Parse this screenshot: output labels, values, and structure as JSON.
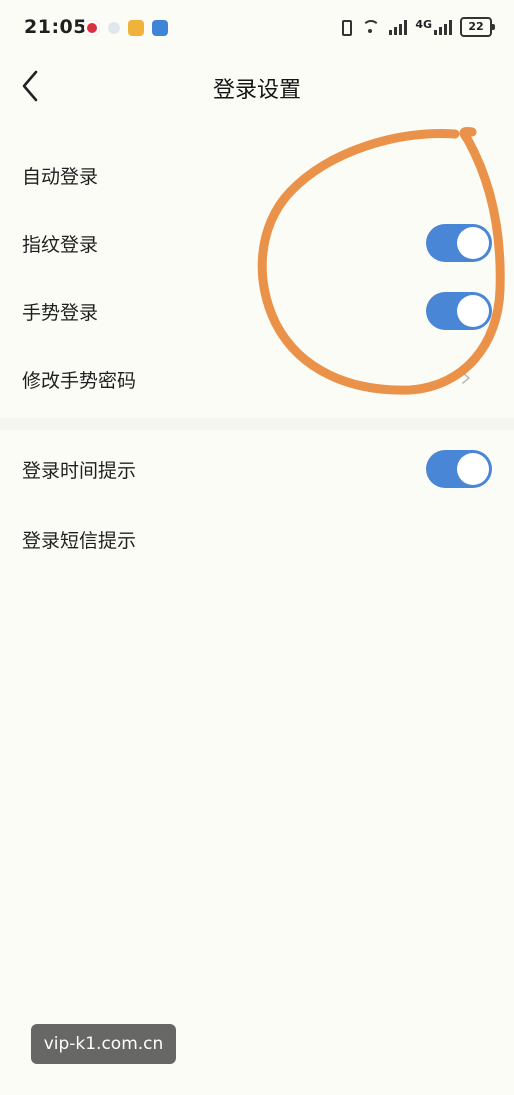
{
  "status_bar": {
    "time": "21:05",
    "network": "4G",
    "battery": "22",
    "notif_icons": [
      "target-icon",
      "dot-icon",
      "folder-icon",
      "compass-icon"
    ]
  },
  "header": {
    "title": "登录设置",
    "back_icon": "chevron-left-icon"
  },
  "settings": [
    {
      "label": "自动登录",
      "control": "none"
    },
    {
      "label": "指纹登录",
      "control": "toggle",
      "on": true
    },
    {
      "label": "手势登录",
      "control": "toggle",
      "on": true
    },
    {
      "label": "修改手势密码",
      "control": "chevron"
    },
    {
      "label": "登录时间提示",
      "control": "toggle",
      "on": true
    },
    {
      "label": "登录短信提示",
      "control": "none"
    }
  ],
  "colors": {
    "toggle_on": "#4a86d6",
    "annotation": "#E8893A",
    "background": "#FCFCF7"
  },
  "watermark": {
    "text": "vip-k1.com.cn"
  }
}
